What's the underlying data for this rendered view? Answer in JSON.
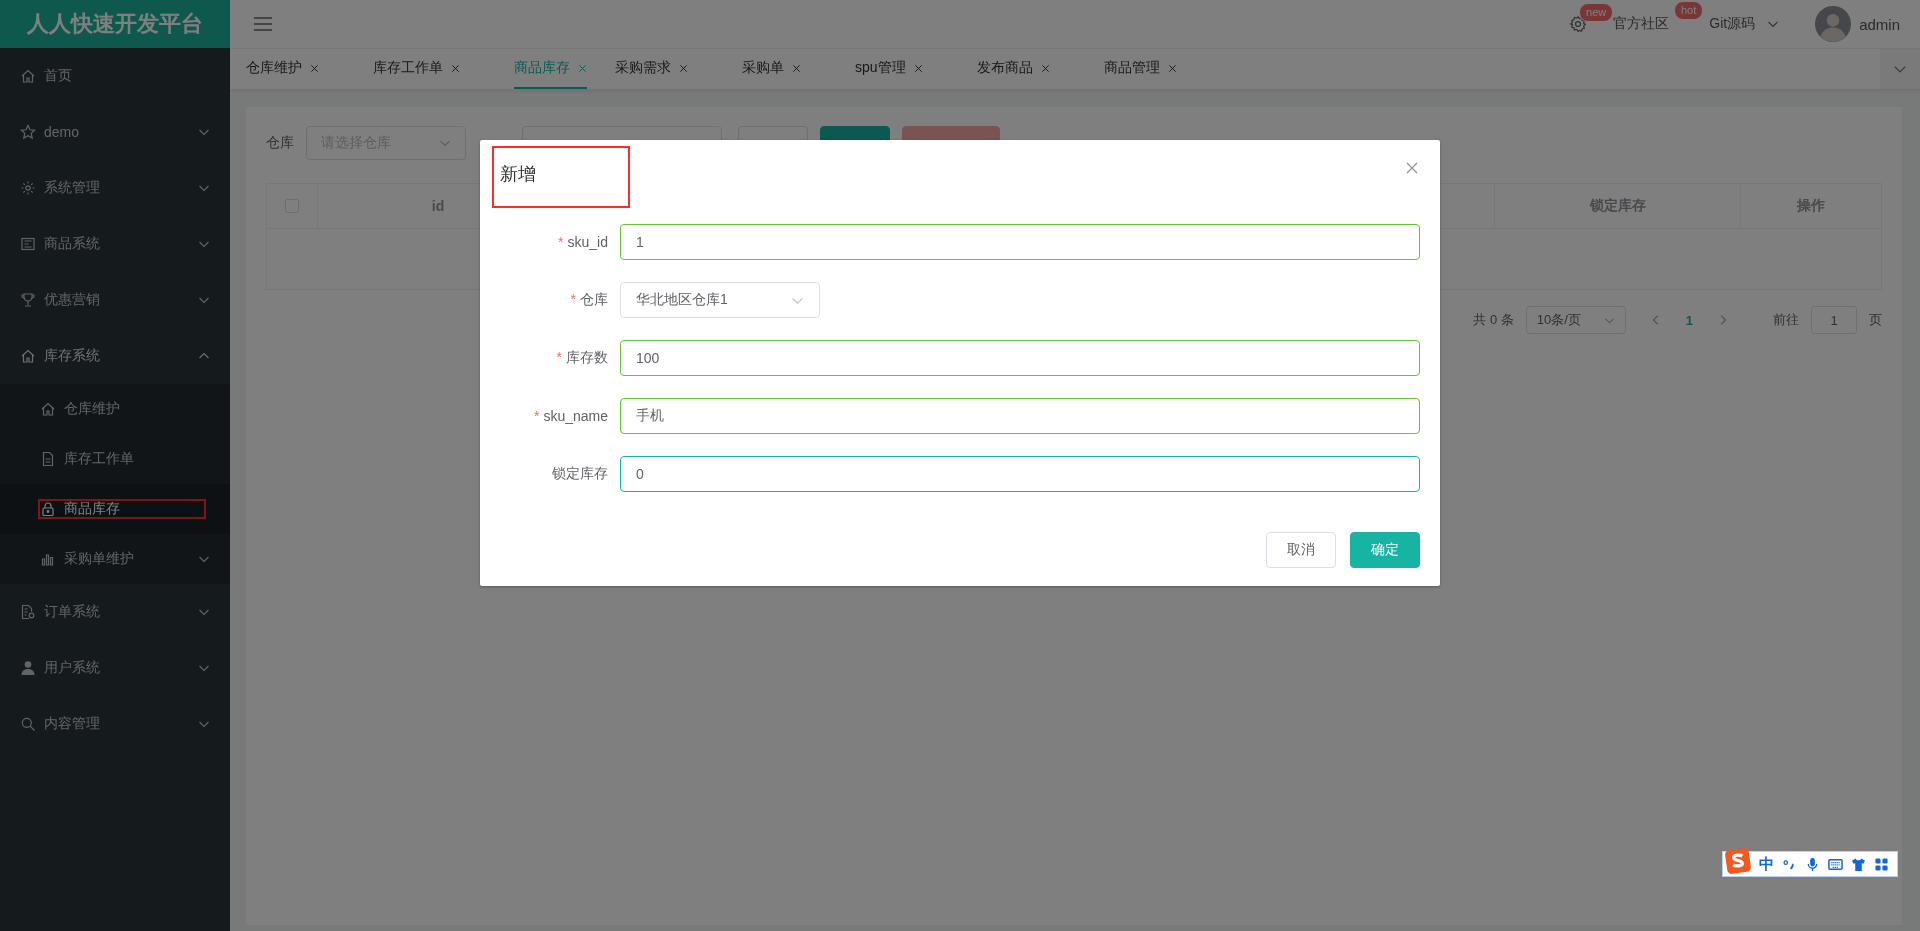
{
  "app": {
    "title": "人人快速开发平台"
  },
  "header": {
    "actions": [
      {
        "kind": "settings",
        "badge": "new"
      },
      {
        "kind": "link",
        "label": "官方社区",
        "badge": "hot"
      },
      {
        "kind": "dropdown",
        "label": "Git源码"
      }
    ],
    "user": {
      "name": "admin"
    }
  },
  "sidebar": {
    "items": [
      {
        "label": "首页",
        "selected": false
      },
      {
        "label": "demo",
        "selected": false,
        "expanded": false
      },
      {
        "label": "系统管理",
        "selected": false,
        "expanded": false
      },
      {
        "label": "商品系统",
        "selected": false,
        "expanded": false
      },
      {
        "label": "优惠营销",
        "selected": false,
        "expanded": false
      },
      {
        "label": "库存系统",
        "selected": false,
        "expanded": true,
        "children": [
          {
            "label": "仓库维护",
            "selected": false
          },
          {
            "label": "库存工作单",
            "selected": false
          },
          {
            "label": "商品库存",
            "selected": true,
            "highlighted": true
          },
          {
            "label": "采购单维护",
            "selected": false,
            "expanded": false
          }
        ]
      },
      {
        "label": "订单系统",
        "selected": false,
        "expanded": false
      },
      {
        "label": "用户系统",
        "selected": false,
        "expanded": false
      },
      {
        "label": "内容管理",
        "selected": false,
        "expanded": false
      }
    ]
  },
  "tabs": [
    {
      "label": "仓库维护",
      "selected": false
    },
    {
      "label": "库存工作单",
      "selected": false
    },
    {
      "label": "商品库存",
      "selected": true
    },
    {
      "label": "采购需求",
      "selected": false
    },
    {
      "label": "采购单",
      "selected": false
    },
    {
      "label": "spu管理",
      "selected": false
    },
    {
      "label": "发布商品",
      "selected": false
    },
    {
      "label": "商品管理",
      "selected": false
    }
  ],
  "toolbar": {
    "warehouse_label": "仓库",
    "warehouse_placeholder": "请选择仓库",
    "buttons": [
      {
        "kind": "default"
      },
      {
        "kind": "primary"
      },
      {
        "kind": "danger"
      }
    ]
  },
  "table": {
    "select_all": {
      "checked": false
    },
    "columns": [
      "id",
      "锁定库存",
      "操作"
    ]
  },
  "pagination": {
    "total": "共 0 条",
    "page_size": "10条/页",
    "pages": [
      {
        "label": "1",
        "selected": true
      }
    ],
    "goto_label": "前往",
    "goto_value": "1",
    "goto_suffix": "页"
  },
  "dialog": {
    "title": "新增",
    "highlighted": true,
    "fields": [
      {
        "kind": "input",
        "required_mark": "*",
        "label": "sku_id",
        "value": "1",
        "valid": true,
        "focused": false
      },
      {
        "kind": "select",
        "required_mark": "*",
        "label": "仓库",
        "value": "华北地区仓库1"
      },
      {
        "kind": "input",
        "required_mark": "*",
        "label": "库存数",
        "value": "100",
        "valid": true,
        "focused": false
      },
      {
        "kind": "input",
        "required_mark": "*",
        "label": "sku_name",
        "value": "手机",
        "valid": true,
        "focused": false
      },
      {
        "kind": "input",
        "label": "锁定库存",
        "value": "0",
        "focused": true
      }
    ],
    "buttons": [
      {
        "label": "取消",
        "kind": "default"
      },
      {
        "label": "确定",
        "kind": "primary"
      }
    ]
  },
  "ime_toolbar": {
    "mode": "中"
  }
}
